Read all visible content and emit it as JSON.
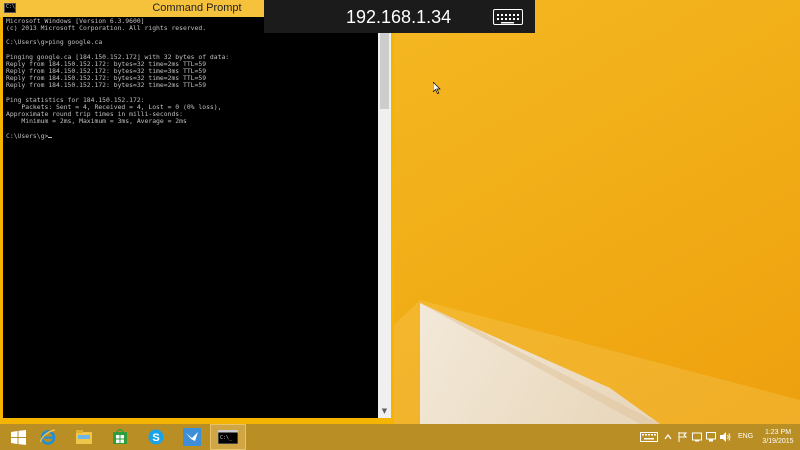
{
  "console_window": {
    "title": "Command Prompt",
    "lines": [
      "Microsoft Windows [Version 6.3.9600]",
      "(c) 2013 Microsoft Corporation. All rights reserved.",
      "",
      "C:\\Users\\g>ping google.ca",
      "",
      "Pinging google.ca [184.150.152.172] with 32 bytes of data:",
      "Reply from 184.150.152.172: bytes=32 time=2ms TTL=59",
      "Reply from 184.150.152.172: bytes=32 time=3ms TTL=59",
      "Reply from 184.150.152.172: bytes=32 time=2ms TTL=59",
      "Reply from 184.150.152.172: bytes=32 time=2ms TTL=59",
      "",
      "Ping statistics for 184.150.152.172:",
      "    Packets: Sent = 4, Received = 4, Lost = 0 (0% loss),",
      "Approximate round trip times in milli-seconds:",
      "    Minimum = 2ms, Maximum = 3ms, Average = 2ms",
      "",
      "C:\\Users\\g>"
    ]
  },
  "remote_bar": {
    "host": "192.168.1.34",
    "keyboard_icon": "keyboard-icon"
  },
  "taskbar": {
    "pinned": [
      {
        "name": "start-button",
        "icon": "windows-logo-icon"
      },
      {
        "name": "taskbar-internet-explorer",
        "icon": "internet-explorer-icon"
      },
      {
        "name": "taskbar-file-explorer",
        "icon": "file-explorer-icon"
      },
      {
        "name": "taskbar-store",
        "icon": "store-icon"
      },
      {
        "name": "taskbar-skype",
        "icon": "skype-icon"
      },
      {
        "name": "taskbar-app-bird",
        "icon": "bird-app-icon"
      },
      {
        "name": "taskbar-command-prompt",
        "icon": "command-prompt-icon",
        "active": true
      }
    ],
    "tray_language": "ENG",
    "clock_time": "1:23 PM",
    "clock_date": "3/19/2015"
  },
  "colors": {
    "wallpaper": "#f2b11a",
    "taskbar": "#b88e25",
    "console_bg": "#000000",
    "console_text": "#c0c0c0"
  }
}
